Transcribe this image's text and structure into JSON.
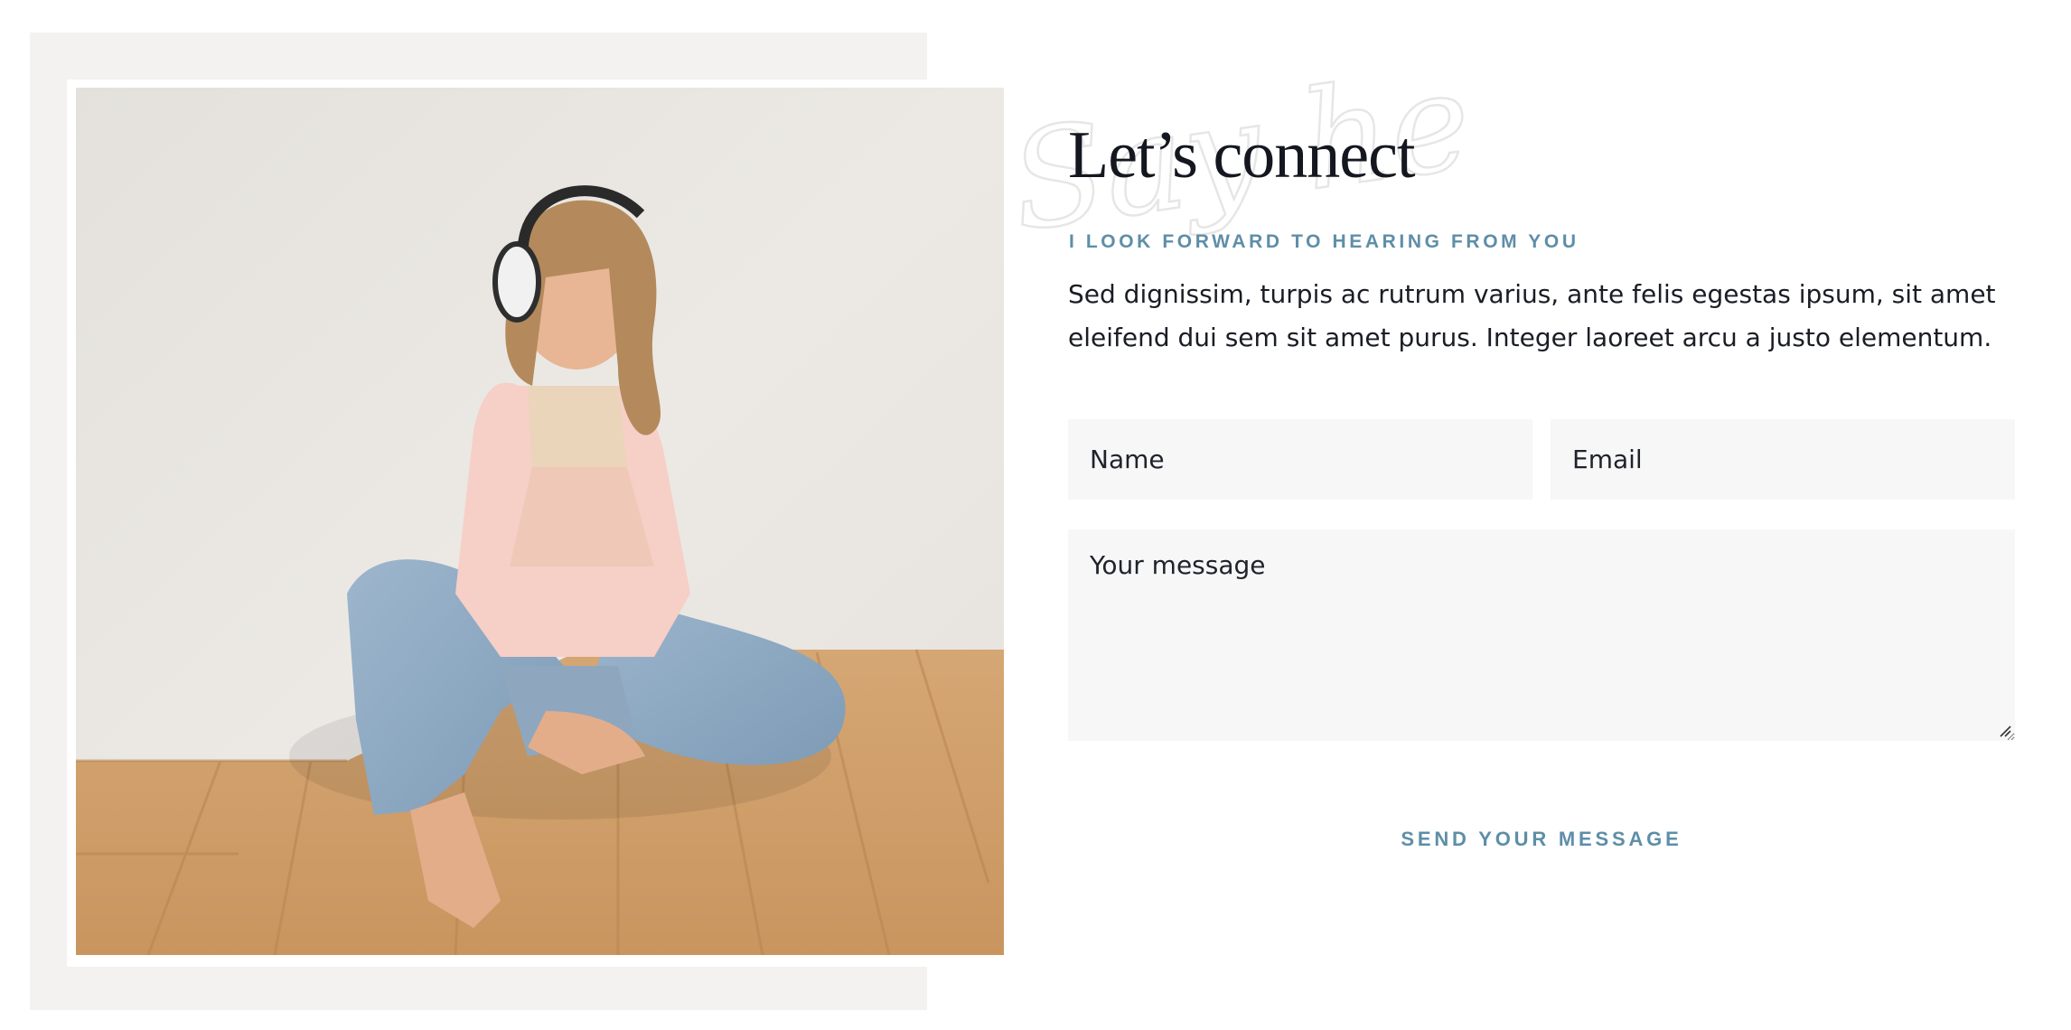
{
  "photo": {
    "alt": "Smiling woman wearing headphones sitting cross-legged on a wooden floor"
  },
  "watermark": {
    "script_text": "Say hello"
  },
  "contact": {
    "heading": "Let’s connect",
    "subheading": "I LOOK FORWARD TO HEARING FROM YOU",
    "intro": "Sed dignissim, turpis ac rutrum varius, ante felis egestas ipsum, sit amet eleifend dui sem sit amet purus. Integer laoreet arcu a justo elementum."
  },
  "form": {
    "name_placeholder": "Name",
    "email_placeholder": "Email",
    "message_placeholder": "Your message",
    "submit_label": "SEND YOUR MESSAGE"
  },
  "colors": {
    "accent": "#5e8ea8",
    "heading": "#14171f",
    "field_background": "#f7f7f7",
    "panel_background": "#f4f2f0"
  }
}
